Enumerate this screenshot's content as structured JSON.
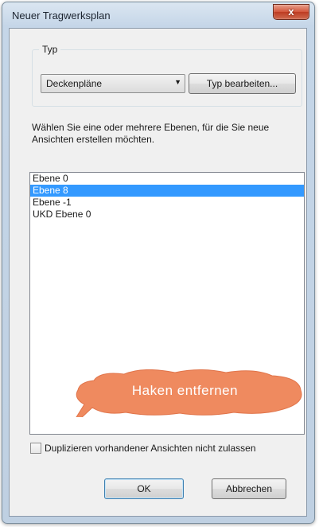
{
  "window": {
    "title": "Neuer Tragwerksplan",
    "close_label": "x"
  },
  "type_group": {
    "legend": "Typ",
    "selected_type": "Deckenpläne",
    "edit_button": "Typ bearbeiten..."
  },
  "instruction": "Wählen Sie eine oder mehrere Ebenen, für die Sie neue Ansichten erstellen möchten.",
  "levels": [
    {
      "label": "Ebene 0",
      "selected": false
    },
    {
      "label": "Ebene 8",
      "selected": true
    },
    {
      "label": "Ebene -1",
      "selected": false
    },
    {
      "label": "UKD Ebene 0",
      "selected": false
    }
  ],
  "callout": {
    "text": "Haken entfernen",
    "color": "#ef8a5f"
  },
  "duplicate_checkbox": {
    "label": "Duplizieren vorhandener Ansichten nicht zulassen",
    "checked": false
  },
  "buttons": {
    "ok": "OK",
    "cancel": "Abbrechen"
  }
}
